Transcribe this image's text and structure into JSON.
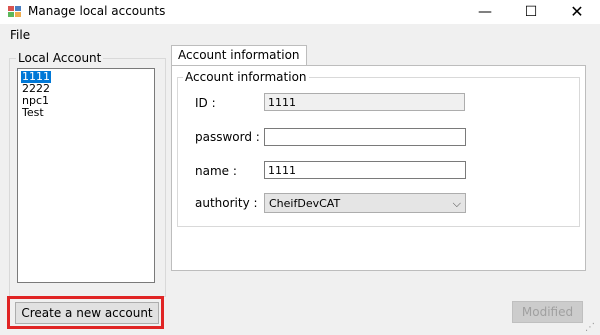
{
  "window": {
    "title": "Manage local accounts",
    "controls": {
      "minimize": "—",
      "maximize": "☐",
      "close": "✕"
    }
  },
  "menu": {
    "file": "File"
  },
  "local_account": {
    "legend": "Local Account",
    "items": [
      "1111",
      "2222",
      "npc1",
      "Test"
    ],
    "selected_index": 0
  },
  "tabs": [
    {
      "label": "Account information",
      "active": true
    }
  ],
  "account_info": {
    "legend": "Account information",
    "id_label": "ID :",
    "id_value": "1111",
    "password_label": "password :",
    "password_value": "",
    "name_label": "name :",
    "name_value": "1111",
    "authority_label": "authority :",
    "authority_value": "CheifDevCAT"
  },
  "buttons": {
    "create": "Create a new account",
    "modified": "Modified"
  },
  "colors": {
    "highlight": "#e02424",
    "selection": "#0078d7",
    "window_bg": "#f0f0f0"
  },
  "icons": {
    "app": "app-window-icon",
    "dropdown": "chevron-down-icon"
  }
}
